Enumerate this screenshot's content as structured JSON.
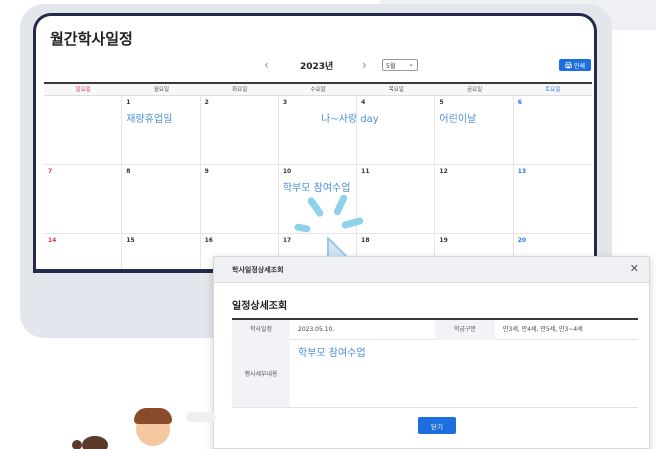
{
  "calendar": {
    "title": "월간학사일정",
    "year": "2023년",
    "prev_icon": "chevron-left-icon",
    "next_icon": "chevron-right-icon",
    "month_select": "5월",
    "print_button": "인쇄",
    "weekdays": [
      "일요일",
      "월요일",
      "화요일",
      "수요일",
      "목요일",
      "금요일",
      "토요일"
    ],
    "weeks": [
      [
        "",
        "1",
        "2",
        "3",
        "4",
        "5",
        "6"
      ],
      [
        "7",
        "8",
        "9",
        "10",
        "11",
        "12",
        "13"
      ],
      [
        "14",
        "15",
        "16",
        "17",
        "18",
        "19",
        "20"
      ]
    ],
    "events": {
      "d1": "재량휴업일",
      "d4": "나~사랑 day",
      "d5": "어린이날",
      "d10": "학부모 참여수업"
    }
  },
  "dialog": {
    "header_title": "학사일정상세조회",
    "close_icon": "close-icon",
    "section_title": "일정상세조회",
    "date_label": "학사일정",
    "date_value": "2023.05.10.",
    "class_label": "학급구분",
    "class_value": "만3세, 만4세, 만5세, 만3~4세",
    "detail_label": "행사세부내용",
    "detail_value": "학부모 참여수업",
    "ok_button": "닫기"
  },
  "colors": {
    "accent": "#1d6fe0",
    "event_text": "#4c8fd8",
    "sunday": "#e0364a",
    "saturday": "#2f74e6"
  }
}
